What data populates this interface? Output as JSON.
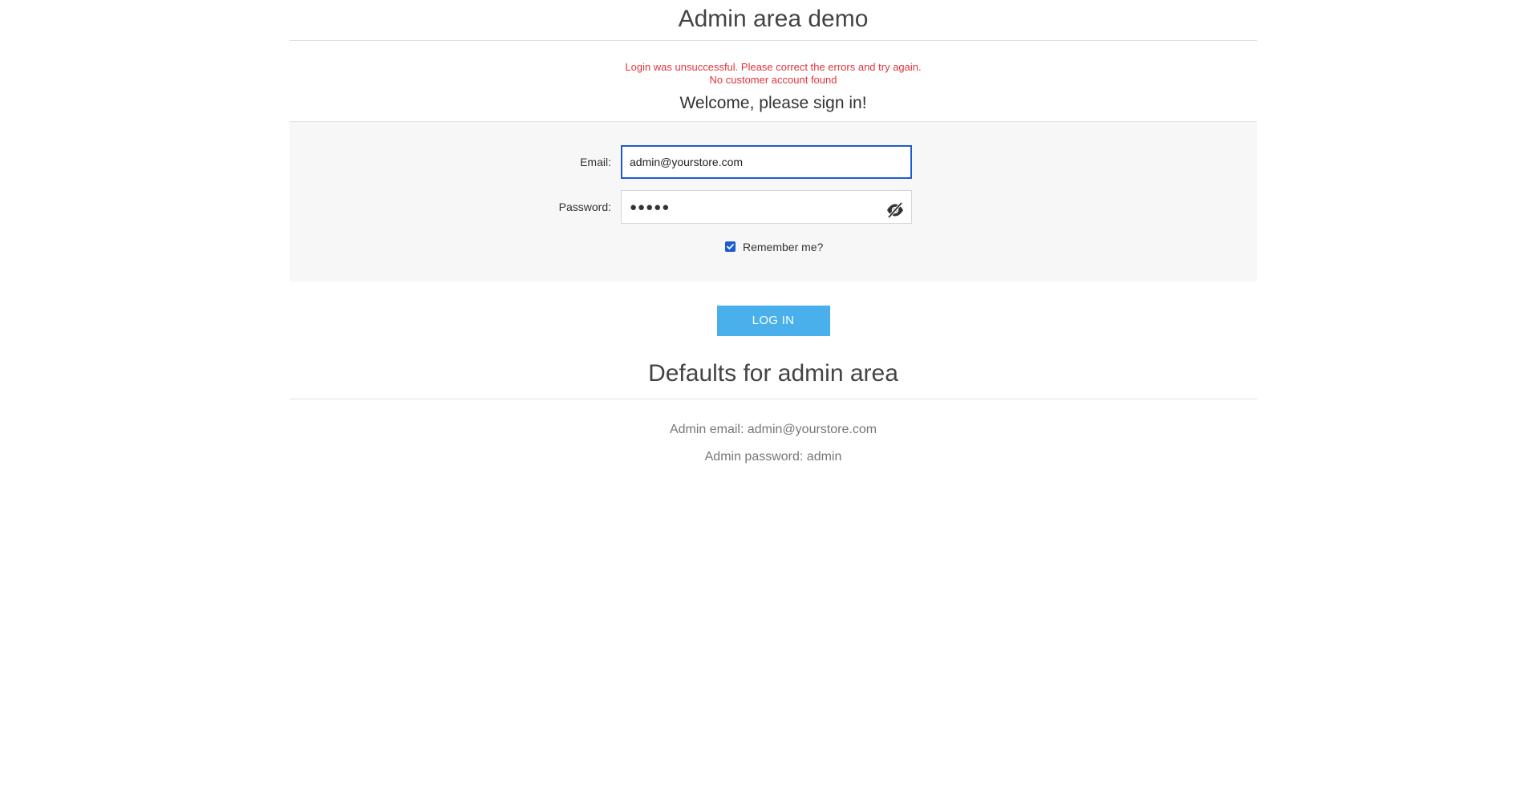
{
  "page": {
    "title": "Admin area demo"
  },
  "errors": {
    "summary": "Login was unsuccessful. Please correct the errors and try again.",
    "detail": "No customer account found"
  },
  "form": {
    "heading": "Welcome, please sign in!",
    "email_label": "Email:",
    "email_value": "admin@yourstore.com",
    "password_label": "Password:",
    "password_masked": "●●●●●",
    "password_toggle_icon": "eye-slash-icon",
    "remember_label": "Remember me?",
    "remember_checked": true,
    "login_label": "LOG IN"
  },
  "defaults": {
    "heading": "Defaults for admin area",
    "email_line": "Admin email: admin@yourstore.com",
    "password_line": "Admin password: admin"
  },
  "colors": {
    "error": "#e0343b",
    "accent": "#1d5bd3",
    "login_button": "#49b0ec",
    "panel_background": "#f7f7f7"
  }
}
